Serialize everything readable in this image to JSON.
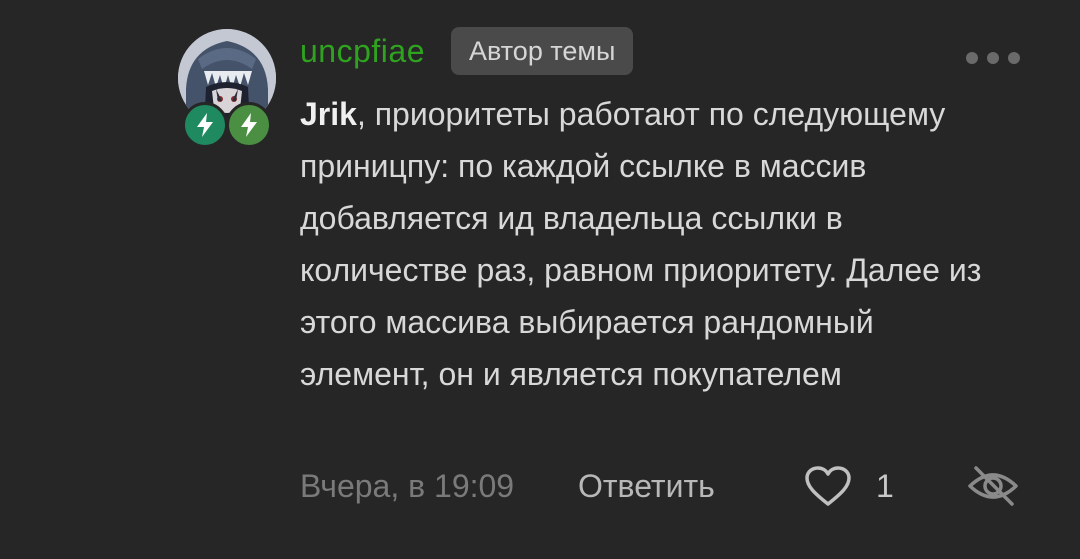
{
  "comment": {
    "author": "uncpfiae",
    "author_badge": "Автор темы",
    "mention": "Jrik",
    "text": ", приоритеты работают по следующему приницпу: по каждой ссылке в массив добавляется ид владельца ссылки в количестве раз, равном приоритету. Далее из этого массива выбирается рандомный элемент, он и является покупателем",
    "timestamp": "Вчера, в 19:09",
    "reply_label": "Ответить",
    "like_count": "1",
    "badges": [
      "bolt-icon",
      "bolt-icon"
    ]
  },
  "colors": {
    "background": "#262626",
    "username": "#2fa31f",
    "author_badge_bg": "#4a4a4a",
    "text": "#d8d8d8",
    "muted": "#7a7a7a",
    "badge_1": "#1f8a5f",
    "badge_2": "#4a8f42"
  },
  "icons": {
    "more": "more-dots-icon",
    "like": "heart-icon",
    "hide": "eye-off-icon"
  }
}
